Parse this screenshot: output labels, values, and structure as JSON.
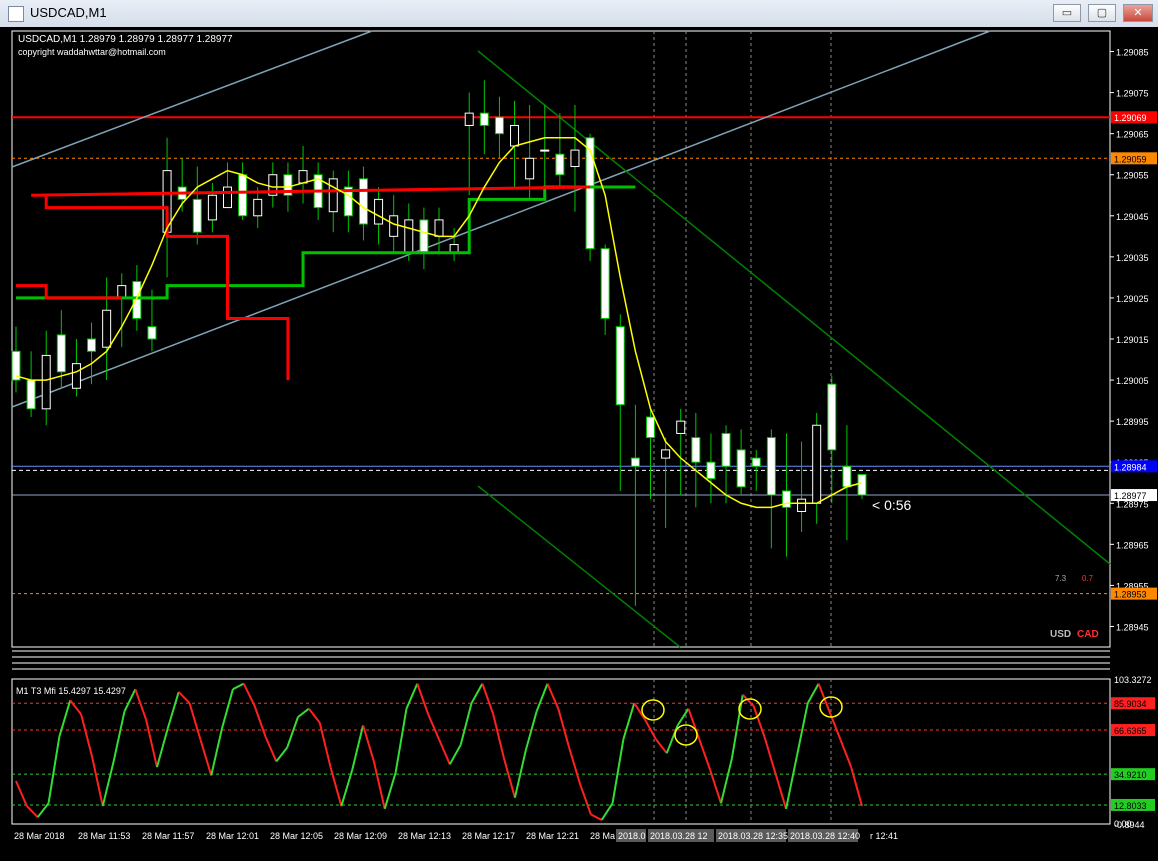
{
  "window": {
    "title": "USDCAD,M1",
    "buttons": {
      "minimize": "▭",
      "restore": "▢",
      "close": "✕"
    }
  },
  "colors": {
    "background": "#000000",
    "grid_text": "#ffffff",
    "candle_body": "#ffffff",
    "candle_wick": "#00c800",
    "ma_yellow": "#ffff00",
    "line_green": "#00c000",
    "line_red": "#ff0000",
    "channel": "#7fa3b5",
    "downtrend": "#008000",
    "level_red": "#ff0000",
    "level_orange": "#ff8800",
    "bid": "#0000ff",
    "mfi_up": "#33dd33",
    "mfi_down": "#ff2020",
    "circle": "#ffff00"
  },
  "main_panel": {
    "header": "USDCAD,M1  1.28979 1.28979 1.28977 1.28977",
    "copyright": "copyright waddahwttar@hotmail.com",
    "countdown": "< 0:56",
    "legend_small": {
      "a": "7.3",
      "b": "0.7"
    },
    "currency_labels": {
      "base": "USD",
      "quote": "CAD"
    }
  },
  "price_axis": {
    "ticks": [
      "1.29085",
      "1.29075",
      "1.29065",
      "1.29055",
      "1.29045",
      "1.29035",
      "1.29025",
      "1.29015",
      "1.29005",
      "1.28995",
      "1.28985",
      "1.28975",
      "1.28965",
      "1.28955",
      "1.28945"
    ],
    "tags": [
      {
        "label": "1.29069",
        "price": 1.29069,
        "kind": "red"
      },
      {
        "label": "1.29059",
        "price": 1.29059,
        "kind": "orange"
      },
      {
        "label": "1.28984",
        "price": 1.28984,
        "kind": "blue"
      },
      {
        "label": "1.28977",
        "price": 1.28977,
        "kind": "white"
      },
      {
        "label": "1.28953",
        "price": 1.28953,
        "kind": "orange"
      }
    ]
  },
  "indicator_panel": {
    "header": "M1  T3 Mfi  15.4297 15.4297",
    "ticks": [
      "103.3272",
      "85.9034",
      "66.6365",
      "34.9210",
      "12.8033",
      "0.00",
      "-0.8944"
    ]
  },
  "time_axis": {
    "labels": [
      "28 Mar 2018",
      "28 Mar 11:53",
      "28 Mar 11:57",
      "28 Mar 12:01",
      "28 Mar 12:05",
      "28 Mar 12:09",
      "28 Mar 12:13",
      "28 Mar 12:17",
      "28 Mar 12:21",
      "28 Ma",
      "2018.0",
      "2018.03.28 12",
      "2018.03.28 12:35",
      "2018.03.28 12:40",
      "r 12:41"
    ]
  },
  "chart_data": [
    {
      "type": "candlestick",
      "title": "USDCAD,M1",
      "ylim": [
        1.2894,
        1.2909
      ],
      "open": [
        1.29012,
        1.29005,
        1.28998,
        1.29016,
        1.29003,
        1.29015,
        1.29013,
        1.29025,
        1.29029,
        1.29018,
        1.29041,
        1.29052,
        1.29049,
        1.29044,
        1.29047,
        1.29055,
        1.29045,
        1.2905,
        1.29055,
        1.29053,
        1.29055,
        1.29046,
        1.29052,
        1.29054,
        1.29043,
        1.2904,
        1.29036,
        1.29044,
        1.2904,
        1.29036,
        1.29067,
        1.2907,
        1.29069,
        1.29062,
        1.29054,
        1.29061,
        1.2906,
        1.29057,
        1.29064,
        1.29037,
        1.29018,
        1.28986,
        1.28996,
        1.28986,
        1.28992,
        1.28991,
        1.28985,
        1.28992,
        1.28988,
        1.28986,
        1.28991,
        1.28978,
        1.28973,
        1.28975,
        1.29004,
        1.28984,
        1.28982
      ],
      "close": [
        1.29005,
        1.28998,
        1.29011,
        1.29007,
        1.29009,
        1.29012,
        1.29022,
        1.29028,
        1.2902,
        1.29015,
        1.29056,
        1.29049,
        1.29041,
        1.2905,
        1.29052,
        1.29045,
        1.29049,
        1.29055,
        1.2905,
        1.29056,
        1.29047,
        1.29054,
        1.29045,
        1.29043,
        1.29049,
        1.29045,
        1.29044,
        1.29036,
        1.29044,
        1.29038,
        1.2907,
        1.29067,
        1.29065,
        1.29067,
        1.29059,
        1.29061,
        1.29055,
        1.29061,
        1.29037,
        1.2902,
        1.28999,
        1.28984,
        1.28991,
        1.28988,
        1.28995,
        1.28985,
        1.28981,
        1.28984,
        1.28979,
        1.28984,
        1.28977,
        1.28974,
        1.28976,
        1.28994,
        1.28988,
        1.28979,
        1.28977
      ],
      "high": [
        1.29018,
        1.29012,
        1.29017,
        1.29022,
        1.29015,
        1.29019,
        1.2903,
        1.29031,
        1.29033,
        1.29027,
        1.29064,
        1.29059,
        1.29057,
        1.29053,
        1.29058,
        1.29058,
        1.29052,
        1.29058,
        1.29058,
        1.29062,
        1.29058,
        1.29056,
        1.29056,
        1.29057,
        1.29052,
        1.2905,
        1.29048,
        1.29047,
        1.29047,
        1.29042,
        1.29075,
        1.29078,
        1.29074,
        1.29073,
        1.29072,
        1.29072,
        1.2907,
        1.29072,
        1.29065,
        1.29038,
        1.29021,
        1.28999,
        1.28998,
        1.28991,
        1.28998,
        1.28997,
        1.28992,
        1.28994,
        1.28993,
        1.28988,
        1.28993,
        1.28992,
        1.2899,
        1.28997,
        1.29006,
        1.28994,
        1.28979
      ],
      "low": [
        1.29002,
        1.28996,
        1.28994,
        1.29003,
        1.29001,
        1.29004,
        1.29005,
        1.29013,
        1.29017,
        1.29012,
        1.2903,
        1.29046,
        1.29038,
        1.29041,
        1.29048,
        1.29044,
        1.29042,
        1.29047,
        1.29046,
        1.29048,
        1.29044,
        1.29041,
        1.29041,
        1.29039,
        1.29038,
        1.29036,
        1.29034,
        1.29032,
        1.29036,
        1.29034,
        1.2905,
        1.2906,
        1.29059,
        1.29052,
        1.29049,
        1.2905,
        1.29052,
        1.29046,
        1.29034,
        1.29016,
        1.28978,
        1.2895,
        1.28976,
        1.28969,
        1.28977,
        1.28974,
        1.28975,
        1.28975,
        1.28977,
        1.28978,
        1.28964,
        1.28962,
        1.28968,
        1.2897,
        1.28975,
        1.28966,
        1.28976
      ],
      "yellow_ma": [
        1.29006,
        1.29005,
        1.29005,
        1.29006,
        1.29007,
        1.29009,
        1.29012,
        1.29018,
        1.29025,
        1.29033,
        1.29042,
        1.29048,
        1.29052,
        1.29054,
        1.29056,
        1.29055,
        1.29053,
        1.29052,
        1.29052,
        1.29053,
        1.29054,
        1.29052,
        1.2905,
        1.29047,
        1.29045,
        1.29043,
        1.29042,
        1.29041,
        1.2904,
        1.2904,
        1.29045,
        1.29052,
        1.29058,
        1.29062,
        1.29063,
        1.29064,
        1.29064,
        1.29064,
        1.29061,
        1.2905,
        1.2903,
        1.29012,
        1.28998,
        1.2899,
        1.28986,
        1.28983,
        1.2898,
        1.28977,
        1.28975,
        1.28974,
        1.28974,
        1.28975,
        1.28975,
        1.28975,
        1.28977,
        1.28979,
        1.2898
      ],
      "green_line": [
        1.29025,
        1.29025,
        1.29025,
        1.29025,
        1.29025,
        1.29025,
        1.29025,
        1.29025,
        1.29025,
        1.29025,
        1.29028,
        1.29028,
        1.29028,
        1.29028,
        1.29028,
        1.29028,
        1.29028,
        1.29028,
        1.29028,
        1.29036,
        1.29036,
        1.29036,
        1.29036,
        1.29036,
        1.29036,
        1.29036,
        1.29036,
        1.29036,
        1.29036,
        1.29036,
        1.29049,
        1.29049,
        1.29049,
        1.29049,
        1.29049,
        1.29052,
        1.29052,
        1.29052,
        1.29052,
        1.29052,
        1.29052,
        1.29052,
        1.29052,
        1.29052,
        1.29052,
        1.29052,
        1.29052,
        1.29052,
        1.29052,
        1.29052,
        1.29052,
        1.29052,
        1.29052,
        1.29052,
        1.29052,
        1.29052,
        1.29052
      ],
      "red_line": [
        1.29028,
        1.29028,
        1.29025,
        1.29025,
        1.29025,
        1.29025,
        1.29025,
        1.29025,
        1.29025,
        1.29025,
        1.29025,
        1.29025,
        1.29025,
        1.29025,
        1.29025,
        1.29025,
        1.29025,
        1.29025,
        1.29025,
        1.29025,
        1.29025,
        1.29025,
        1.29025,
        1.29025,
        1.29025,
        1.29025,
        1.29025,
        1.29025,
        1.29025,
        1.29025,
        1.29025,
        1.29025,
        1.29025,
        1.29025,
        1.29025,
        1.29025,
        1.29025,
        1.29025,
        1.2905,
        1.2905,
        1.29047,
        1.29047,
        1.29047,
        1.29047,
        1.29047,
        1.29047,
        1.29047,
        1.29047,
        1.2904,
        1.2904,
        1.2904,
        1.2904,
        1.2902,
        1.2902,
        1.2902,
        1.2902,
        1.29005
      ]
    },
    {
      "type": "line",
      "title": "M1  T3 Mfi  15.4297 15.4297",
      "ylim": [
        -0.8944,
        103.3272
      ],
      "series": [
        {
          "name": "T3 Mfi",
          "values": [
            30,
            12,
            4,
            14,
            62,
            88,
            78,
            48,
            12,
            44,
            80,
            96,
            74,
            40,
            68,
            94,
            86,
            60,
            34,
            68,
            96,
            100,
            84,
            62,
            44,
            54,
            76,
            82,
            72,
            40,
            12,
            38,
            70,
            44,
            10,
            36,
            82,
            100,
            78,
            60,
            42,
            56,
            86,
            100,
            78,
            46,
            18,
            52,
            80,
            100,
            82,
            54,
            28,
            6,
            2,
            14,
            60,
            86,
            74,
            60,
            50,
            70,
            82,
            60,
            38,
            14,
            46,
            92,
            84,
            62,
            36,
            10,
            48,
            86,
            100,
            80,
            60,
            40,
            12
          ]
        }
      ],
      "levels": [
        85.9034,
        66.6365,
        34.921,
        12.8033
      ]
    }
  ]
}
